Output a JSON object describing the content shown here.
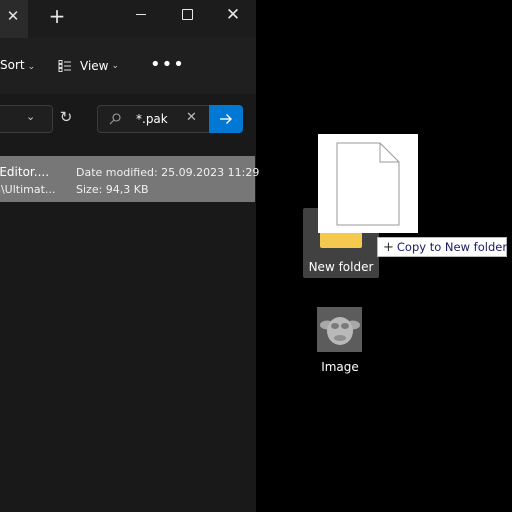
{
  "titlebar": {
    "close_tab_glyph": "✕",
    "new_tab_glyph": "+",
    "close_window_glyph": "✕"
  },
  "toolbar": {
    "sort_label": "Sort",
    "view_label": "View",
    "more_glyph": "•••",
    "chevron_glyph": "⌄"
  },
  "address_bar": {
    "chevron_glyph": "⌄",
    "refresh_glyph": "↻",
    "search_value": "*.pak",
    "clear_glyph": "✕"
  },
  "file_list": {
    "items": [
      {
        "name": "oEditor....",
        "path": "n\\Ultimat...",
        "modified": "Date modified: 25.09.2023 11:29",
        "size": "Size: 94,3 KB",
        "selected": true
      }
    ]
  },
  "desktop": {
    "folder_label": "New folder",
    "image_label": "Image",
    "drag_tooltip": {
      "plus_glyph": "+",
      "text": "Copy to New folder"
    }
  },
  "colors": {
    "accent": "#0078d4",
    "folder": "#f5c94d",
    "selection": "#777777"
  },
  "icons": [
    "close-icon",
    "plus-icon",
    "minimize-icon",
    "maximize-icon",
    "view-icon",
    "more-icon",
    "chevron-down-icon",
    "refresh-icon",
    "search-icon",
    "arrow-right-icon",
    "file-icon",
    "folder-icon"
  ]
}
